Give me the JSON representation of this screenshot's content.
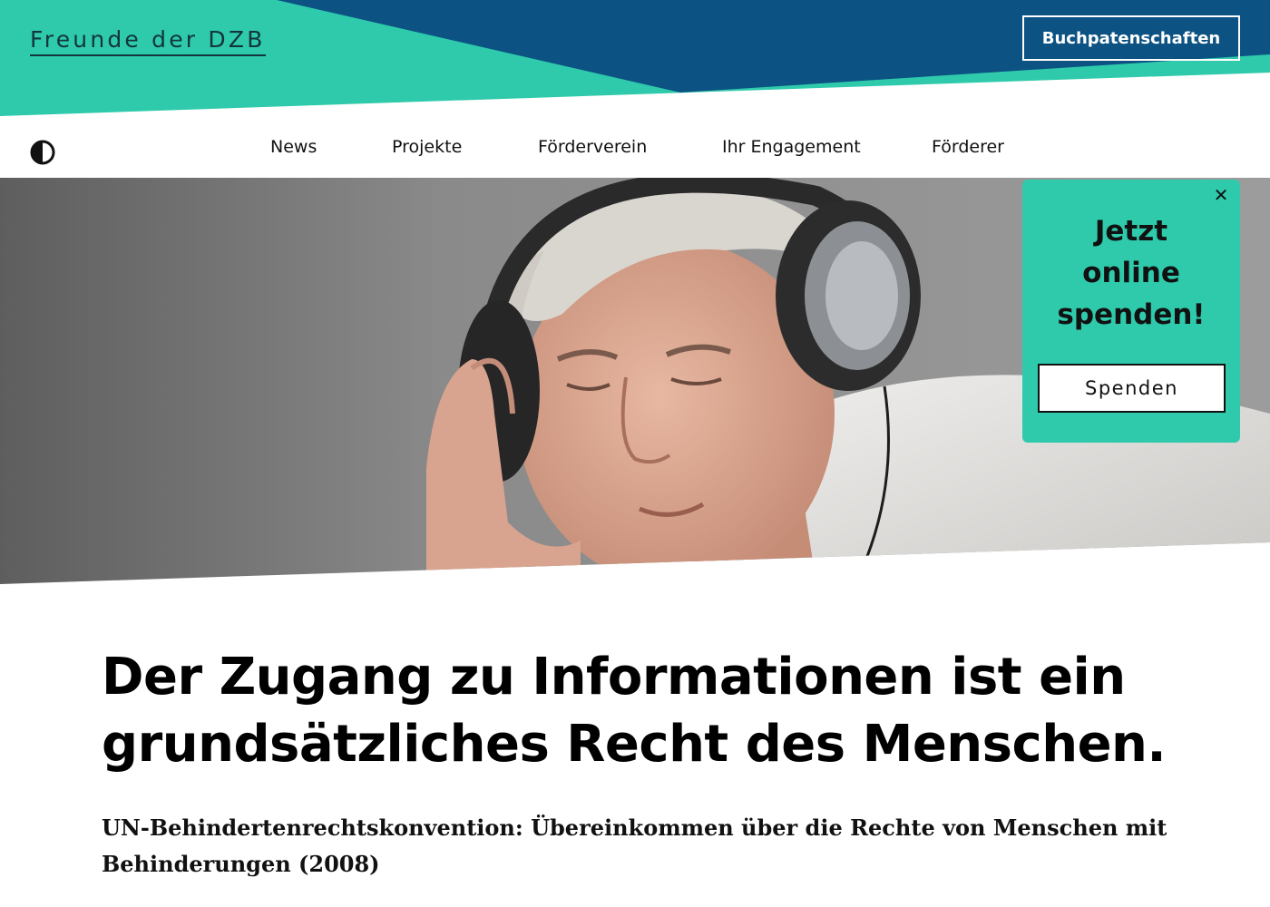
{
  "header": {
    "logo_text": "Freunde der DZB",
    "cta_label": "Buchpatenschaften"
  },
  "nav": {
    "contrast_toggle_icon": "contrast-icon",
    "items": [
      {
        "label": "News"
      },
      {
        "label": "Projekte"
      },
      {
        "label": "Förderverein"
      },
      {
        "label": "Ihr Engagement"
      },
      {
        "label": "Förderer"
      }
    ]
  },
  "hero": {
    "image_subject": "man-with-headphones"
  },
  "donate_popup": {
    "title": "Jetzt\nonline\nspenden!",
    "close_icon": "close-icon",
    "button_label": "Spenden"
  },
  "content": {
    "headline": "Der Zugang zu Informationen ist ein grundsätzliches Recht des Menschen.",
    "source": "UN-Behindertenrechtskonvention: Übereinkommen über die Rechte von Menschen mit Behinderungen (2008)"
  },
  "colors": {
    "teal": "#2ecaab",
    "navy": "#0c5283",
    "text": "#111111"
  }
}
